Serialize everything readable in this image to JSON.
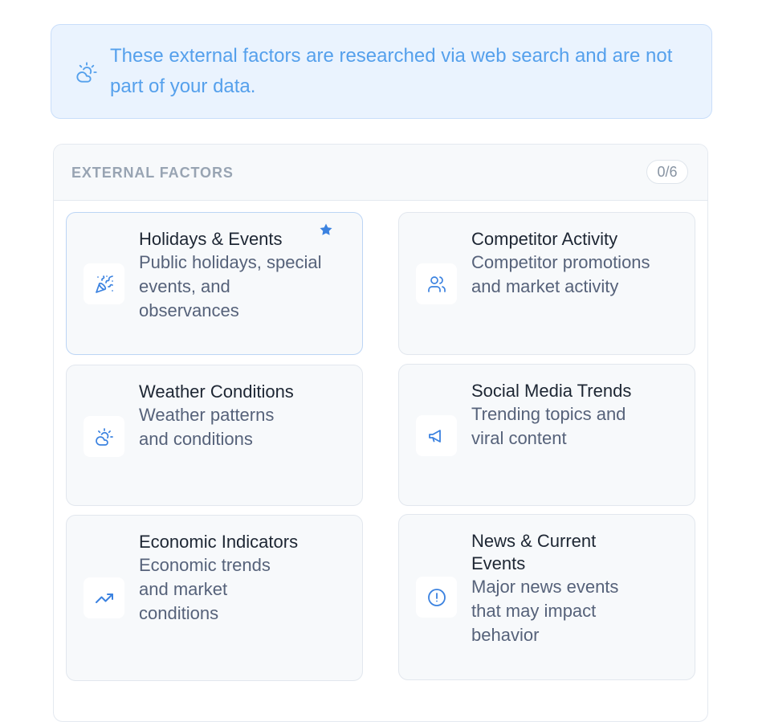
{
  "notice": {
    "icon": "weather-icon",
    "text": "These external factors are researched via web search and are not part of your data."
  },
  "panel": {
    "title": "EXTERNAL FACTORS",
    "count": "0/6"
  },
  "factors": [
    {
      "icon": "party-popper-icon",
      "title": "Holidays & Events",
      "description": "Public holidays, special events, and observances",
      "recommended": true
    },
    {
      "icon": "users-icon",
      "title": "Competitor Activity",
      "description": "Competitor promotions and market activity"
    },
    {
      "icon": "weather-icon",
      "title": "Weather Conditions",
      "description": "Weather patterns and conditions"
    },
    {
      "icon": "megaphone-icon",
      "title": "Social Media Trends",
      "description": "Trending topics and viral content"
    },
    {
      "icon": "trending-up-icon",
      "title": "Economic Indicators",
      "description": "Economic trends and market conditions"
    },
    {
      "icon": "alert-circle-icon",
      "title": "News & Current Events",
      "description": "Major news events that may impact behavior"
    }
  ],
  "colors": {
    "accent": "#3b82e0",
    "notice_text": "#55a0ec",
    "notice_bg": "#eaf3fe"
  }
}
